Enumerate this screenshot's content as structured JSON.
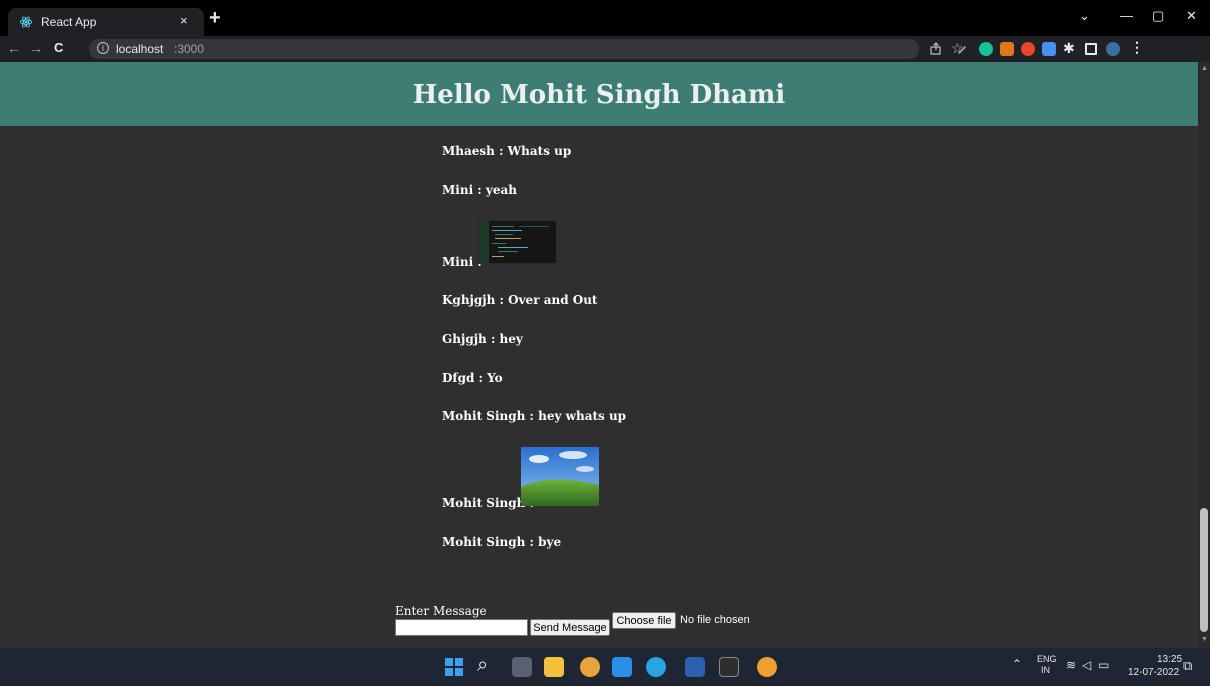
{
  "browser": {
    "tab_title": "React App",
    "tab_close": "×",
    "new_tab": "+",
    "url_host": "localhost",
    "url_port": ":3000",
    "nav": {
      "back": "←",
      "forward": "→",
      "reload": "C"
    },
    "window_controls": {
      "tabs_dropdown": "⌄",
      "minimize": "—",
      "maximize": "▢",
      "close": "✕"
    }
  },
  "header": {
    "title": "Hello Mohit Singh Dhami"
  },
  "messages": [
    {
      "sender": "Mhaesh",
      "text": "Whats up"
    },
    {
      "sender": "Mini",
      "text": "yeah"
    },
    {
      "sender": "Mini",
      "text": "",
      "image": "code-screenshot"
    },
    {
      "sender": "Kghjgjh",
      "text": "Over and Out"
    },
    {
      "sender": "Ghjgjh",
      "text": "hey"
    },
    {
      "sender": "Dfgd",
      "text": "Yo"
    },
    {
      "sender": "Mohit Singh",
      "text": "hey whats up"
    },
    {
      "sender": "Mohit Singh",
      "text": "",
      "image": "bliss-wallpaper"
    },
    {
      "sender": "Mohit Singh",
      "text": "bye"
    }
  ],
  "message_lines": [
    "Mhaesh : Whats up",
    "Mini : yeah",
    "Mini :",
    "Kghjgjh : Over and Out",
    "Ghjgjh : hey",
    "Dfgd : Yo",
    "Mohit Singh : hey whats up",
    "Mohit Singh :",
    "Mohit Singh : bye"
  ],
  "compose": {
    "label": "Enter Message",
    "input_value": "",
    "send_label": "Send Message",
    "choose_file_label": "Choose file",
    "file_status": "No file chosen"
  },
  "taskbar": {
    "lang_top": "ENG",
    "lang_bottom": "IN",
    "time": "13:25",
    "date": "12-07-2022"
  },
  "colors": {
    "header_bg": "#3d7d73",
    "page_bg": "#2f2f2f",
    "taskbar_bg": "#1f2633"
  }
}
